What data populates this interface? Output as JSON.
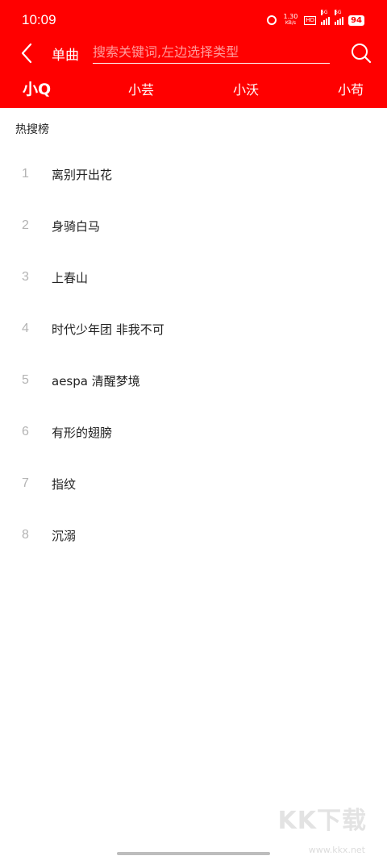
{
  "status_bar": {
    "time": "10:09",
    "network_speed_value": "1.30",
    "network_speed_unit": "KB/s",
    "hd_label": "HD",
    "signal1_label": "5G",
    "signal2_label": "5G",
    "battery": "94"
  },
  "header": {
    "category_label": "单曲",
    "search_placeholder": "搜索关键词,左边选择类型",
    "tabs": [
      {
        "label": "小Q",
        "active": true
      },
      {
        "label": "小芸",
        "active": false
      },
      {
        "label": "小沃",
        "active": false
      },
      {
        "label": "小苟",
        "active": false
      }
    ]
  },
  "hot_search": {
    "title": "热搜榜",
    "items": [
      {
        "rank": "1",
        "text": "离别开出花"
      },
      {
        "rank": "2",
        "text": "身骑白马"
      },
      {
        "rank": "3",
        "text": "上春山"
      },
      {
        "rank": "4",
        "text": "时代少年团 非我不可"
      },
      {
        "rank": "5",
        "text": "aespa 清醒梦境"
      },
      {
        "rank": "6",
        "text": "有形的翅膀"
      },
      {
        "rank": "7",
        "text": "指纹"
      },
      {
        "rank": "8",
        "text": "沉溺"
      }
    ]
  },
  "watermark": {
    "logo": "KK下载",
    "url": "www.kkx.net"
  },
  "colors": {
    "accent": "#ff0000",
    "rank_color": "#b3b3b3",
    "text_color": "#222222"
  }
}
